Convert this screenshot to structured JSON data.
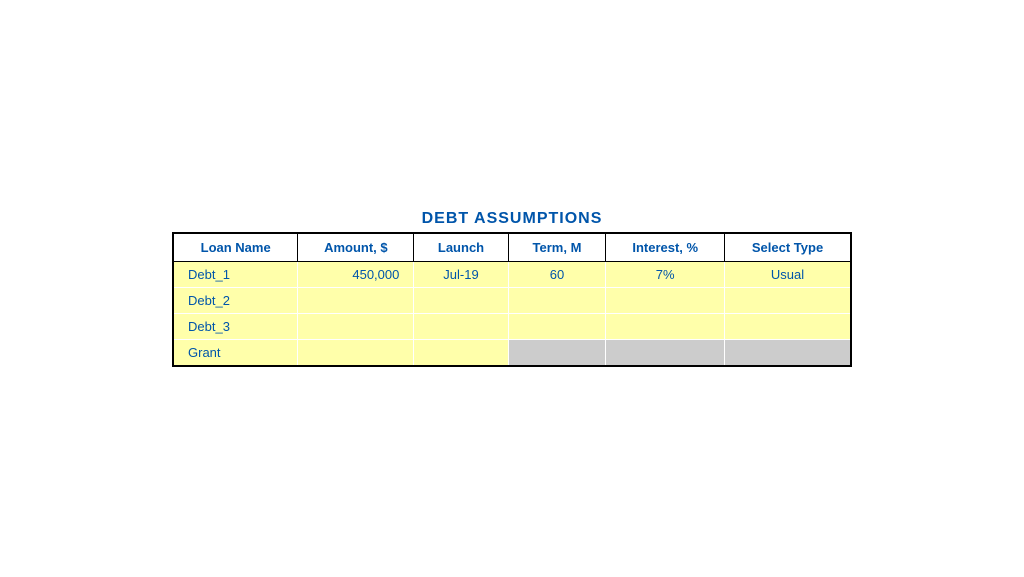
{
  "title": "DEBT ASSUMPTIONS",
  "columns": [
    {
      "key": "loan_name",
      "label": "Loan Name"
    },
    {
      "key": "amount",
      "label": "Amount, $"
    },
    {
      "key": "launch",
      "label": "Launch"
    },
    {
      "key": "term",
      "label": "Term, M"
    },
    {
      "key": "interest",
      "label": "Interest, %"
    },
    {
      "key": "select_type",
      "label": "Select Type"
    }
  ],
  "rows": [
    {
      "loan_name": "Debt_1",
      "amount": "450,000",
      "launch": "Jul-19",
      "term": "60",
      "interest": "7%",
      "select_type": "Usual",
      "grant_row": false
    },
    {
      "loan_name": "Debt_2",
      "amount": "",
      "launch": "",
      "term": "",
      "interest": "",
      "select_type": "",
      "grant_row": false
    },
    {
      "loan_name": "Debt_3",
      "amount": "",
      "launch": "",
      "term": "",
      "interest": "",
      "select_type": "",
      "grant_row": false
    },
    {
      "loan_name": "Grant",
      "amount": "",
      "launch": "",
      "term": null,
      "interest": null,
      "select_type": null,
      "grant_row": true
    }
  ]
}
